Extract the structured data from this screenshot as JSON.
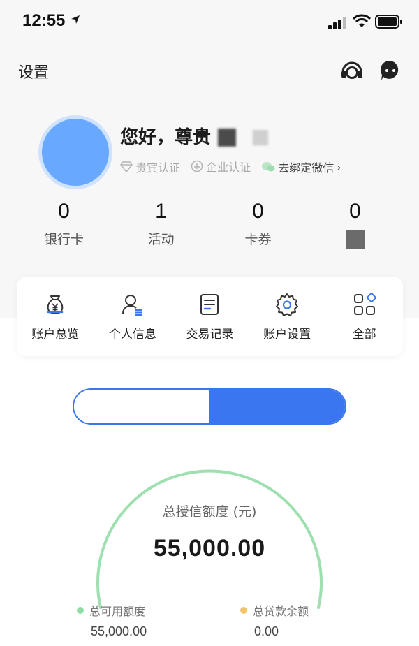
{
  "status_bar": {
    "time": "12:55"
  },
  "header": {
    "title": "设置",
    "icons": [
      "customer-service-icon",
      "message-icon"
    ]
  },
  "profile": {
    "greeting": "您好，尊贵",
    "badges": [
      {
        "label": "贵宾认证",
        "icon": "diamond-icon"
      },
      {
        "label": "企业认证",
        "icon": "enterprise-icon"
      },
      {
        "label": "去绑定微信",
        "icon": "wechat-icon"
      }
    ]
  },
  "stats": [
    {
      "value": "0",
      "label": "银行卡"
    },
    {
      "value": "1",
      "label": "活动"
    },
    {
      "value": "0",
      "label": "卡券"
    },
    {
      "value": "0",
      "label": ""
    }
  ],
  "menu": [
    {
      "label": "账户总览",
      "icon": "money-bag-icon"
    },
    {
      "label": "个人信息",
      "icon": "person-icon"
    },
    {
      "label": "交易记录",
      "icon": "document-icon"
    },
    {
      "label": "账户设置",
      "icon": "gear-icon"
    },
    {
      "label": "全部",
      "icon": "grid-icon"
    }
  ],
  "credit": {
    "title": "总授信额度 (元)",
    "amount": "55,000.00",
    "available_label": "总可用额度",
    "available_value": "55,000.00",
    "loan_label": "总贷款余额",
    "loan_value": "0.00",
    "available_fraction": 1.0
  },
  "colors": {
    "accent": "#3a76f0",
    "gauge_green": "#9fe0b0",
    "available_dot": "#8fdca6",
    "loan_dot": "#f2c36b"
  }
}
